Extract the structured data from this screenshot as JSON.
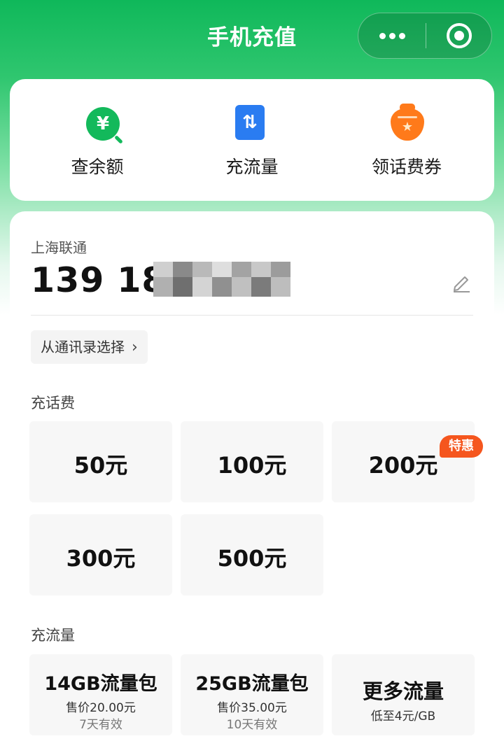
{
  "header": {
    "title": "手机充值",
    "more_icon": "more-dots-icon",
    "close_icon": "mini-program-close-icon",
    "accent_color": "#13b95b"
  },
  "quick_actions": [
    {
      "label": "查余额",
      "icon": "yuan-search-icon",
      "icon_text": "¥"
    },
    {
      "label": "充流量",
      "icon": "data-transfer-icon",
      "icon_text": "⇅"
    },
    {
      "label": "领话费券",
      "icon": "coupon-bag-icon",
      "icon_text": "★"
    }
  ],
  "account": {
    "carrier": "上海联通",
    "phone_visible": "139 18",
    "edit_icon": "pencil-icon",
    "contacts_label": "从通讯录选择",
    "contacts_chevron": "›"
  },
  "topup": {
    "label": "充话费",
    "amounts": [
      "50元",
      "100元",
      "200元",
      "300元",
      "500元"
    ]
  },
  "data_plans": {
    "label": "充流量",
    "packages": [
      {
        "name": "14GB流量包",
        "price": "售价20.00元",
        "validity": "7天有效"
      },
      {
        "name": "25GB流量包",
        "price": "售价35.00元",
        "validity": "10天有效"
      }
    ],
    "more": {
      "name": "更多流量",
      "sub": "低至4元/GB",
      "badge": "特惠",
      "badge_color": "#f5561e"
    }
  }
}
